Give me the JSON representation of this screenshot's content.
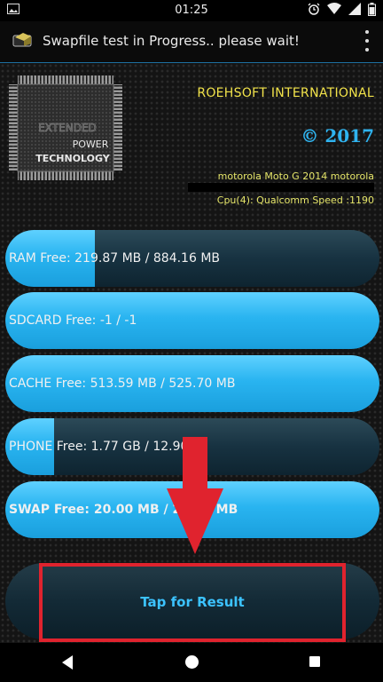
{
  "status_bar": {
    "time": "01:25",
    "icons": [
      "alarm-icon",
      "wifi-icon",
      "signal-icon",
      "battery-icon"
    ]
  },
  "app_bar": {
    "title": "Swapfile test in Progress.. please wait!",
    "menu_icon": "overflow-menu-icon"
  },
  "header": {
    "chip_line1": "EXTENDED",
    "chip_line2": "POWER",
    "chip_line3": "TECHNOLOGY",
    "brand": "ROEHSOFT INTERNATIONAL",
    "copyright": "© 2017",
    "device": "motorola Moto G 2014 motorola",
    "cpu": "Cpu(4): Qualcomm Speed :1190"
  },
  "meters": [
    {
      "key": "ram",
      "label": "RAM  Free: 219.87 MB / 884.16 MB",
      "fill_fraction": 0.24
    },
    {
      "key": "sdcard",
      "label": "SDCARD Free: -1 / -1",
      "fill_fraction": 1.0
    },
    {
      "key": "cache",
      "label": "CACHE Free: 513.59 MB / 525.70 MB",
      "fill_fraction": 1.0
    },
    {
      "key": "phone",
      "label": "PHONE Free: 1.77 GB / 12.90",
      "fill_fraction": 0.13
    },
    {
      "key": "swap",
      "label": "SWAP  Free: 20.00 MB / 20.00 MB",
      "fill_fraction": 1.0
    }
  ],
  "result": {
    "label": "Tap for Result"
  },
  "colors": {
    "accent_blue": "#29b4f0",
    "brand_yellow": "#f2e34a",
    "highlight_red": "#e0232e",
    "result_text": "#3cc3ff"
  }
}
